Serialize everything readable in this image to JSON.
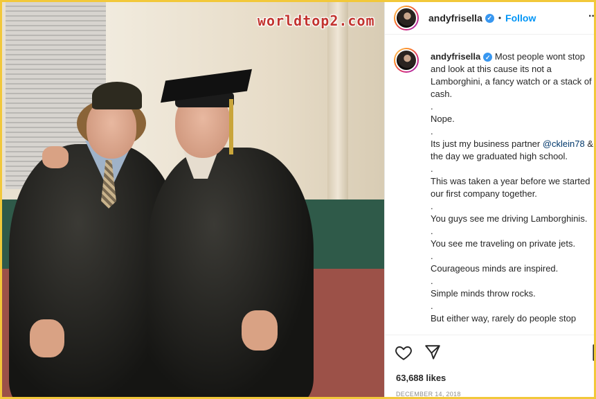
{
  "watermark": "worldtop2.com",
  "post": {
    "username": "andyfrisella",
    "verified_glyph": "✓",
    "dot": "•",
    "follow_label": "Follow",
    "more_glyph": "···",
    "caption_lines": [
      "Most people wont stop and look at this cause its not a Lamborghini, a fancy watch or a stack of cash.",
      ".",
      "Nope.",
      ".",
      "Its just my business partner ",
      ".",
      "This was taken a year before we started our first company together.",
      ".",
      "You guys see me driving Lamborghinis.",
      ".",
      "You see me traveling on private jets.",
      ".",
      "Courageous minds are inspired.",
      ".",
      "Simple minds throw rocks.",
      ".",
      "But either way, rarely do people stop"
    ],
    "mention": "@cklein78",
    "mention_suffix": " & I the day we graduated high school.",
    "likes": "63,688 likes",
    "date": "DECEMBER 14, 2018"
  },
  "icons": {
    "like": "heart-icon",
    "share": "send-icon",
    "save": "bookmark-icon",
    "more": "more-icon",
    "verified": "verified-badge-icon"
  },
  "colors": {
    "follow": "#0095f6",
    "verified": "#3897f0",
    "frame": "#f2c83a",
    "watermark": "#c2342f"
  }
}
